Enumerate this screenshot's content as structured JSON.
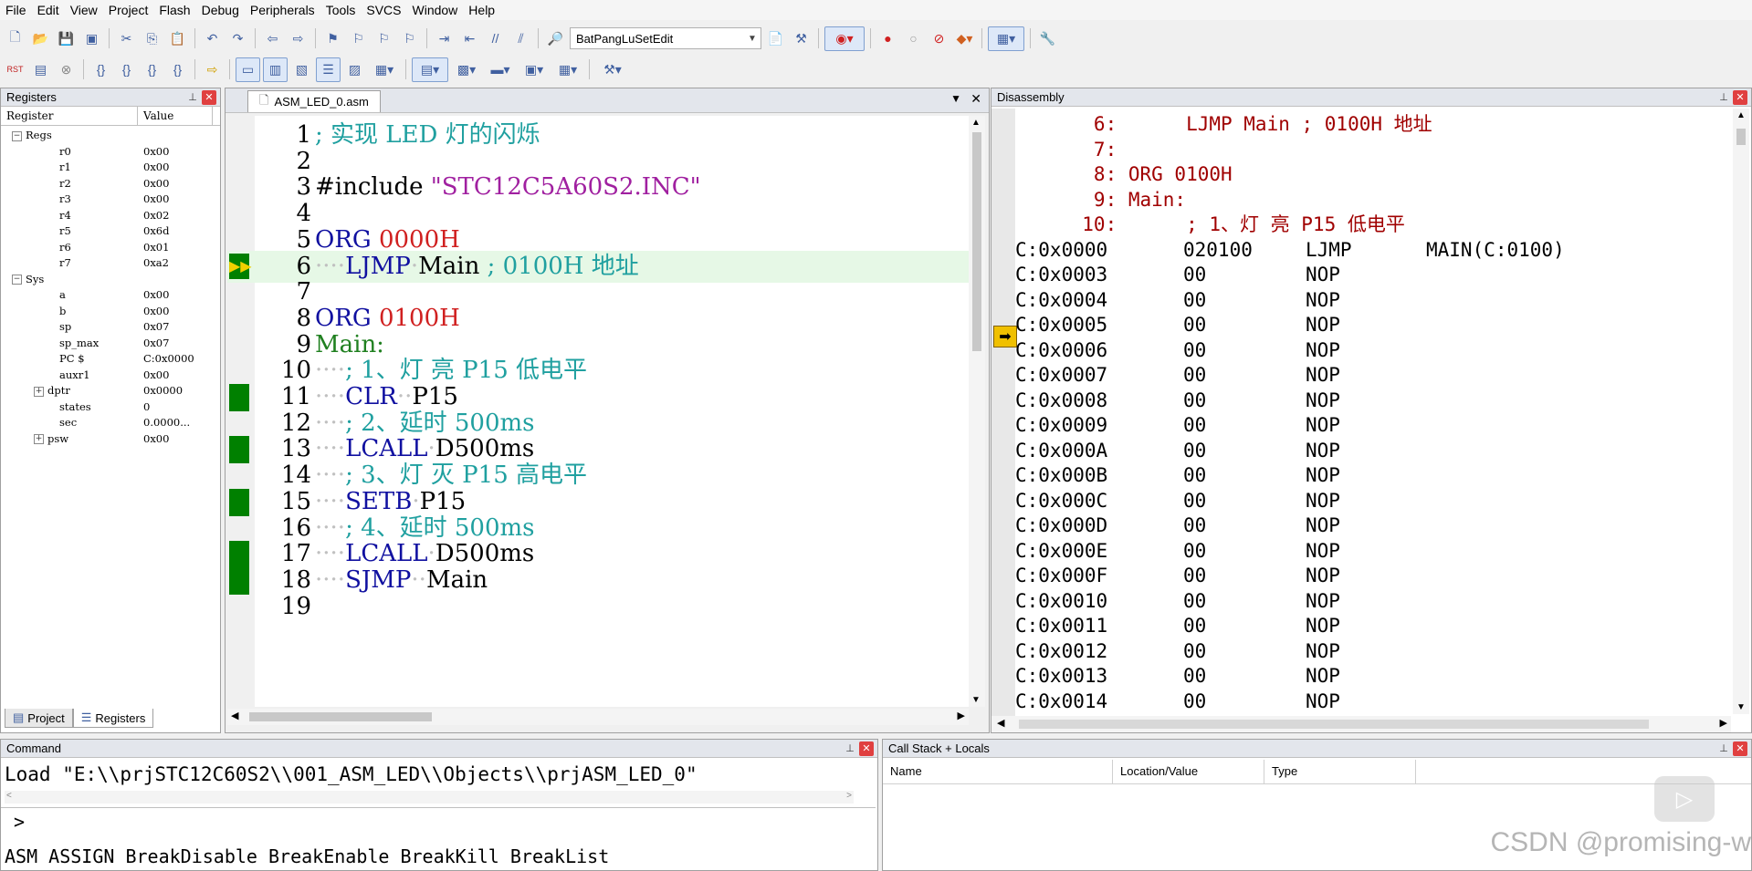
{
  "menubar": [
    "File",
    "Edit",
    "View",
    "Project",
    "Flash",
    "Debug",
    "Peripherals",
    "Tools",
    "SVCS",
    "Window",
    "Help"
  ],
  "toolbar": {
    "target_combo": "BatPangLuSetEdit",
    "rst_label": "RST"
  },
  "registers_panel": {
    "title": "Registers",
    "col_register": "Register",
    "col_value": "Value",
    "groups": [
      {
        "name": "Regs",
        "rows": [
          {
            "name": "r0",
            "value": "0x00"
          },
          {
            "name": "r1",
            "value": "0x00"
          },
          {
            "name": "r2",
            "value": "0x00"
          },
          {
            "name": "r3",
            "value": "0x00"
          },
          {
            "name": "r4",
            "value": "0x02"
          },
          {
            "name": "r5",
            "value": "0x6d"
          },
          {
            "name": "r6",
            "value": "0x01"
          },
          {
            "name": "r7",
            "value": "0xa2"
          }
        ]
      },
      {
        "name": "Sys",
        "rows": [
          {
            "name": "a",
            "value": "0x00"
          },
          {
            "name": "b",
            "value": "0x00"
          },
          {
            "name": "sp",
            "value": "0x07"
          },
          {
            "name": "sp_max",
            "value": "0x07"
          },
          {
            "name": "PC  $",
            "value": "C:0x0000"
          },
          {
            "name": "auxr1",
            "value": "0x00"
          },
          {
            "name": "dptr",
            "value": "0x0000"
          },
          {
            "name": "states",
            "value": "0"
          },
          {
            "name": "sec",
            "value": "0.0000..."
          },
          {
            "name": "psw",
            "value": "0x00"
          }
        ]
      }
    ],
    "tab_project": "Project",
    "tab_registers": "Registers"
  },
  "editor": {
    "tab_label": "ASM_LED_0.asm",
    "lines": [
      {
        "n": "1",
        "text": "; 实现 LED 灯的闪烁"
      },
      {
        "n": "2",
        "text": ""
      },
      {
        "n": "3",
        "text": "#include \"STC12C5A60S2.INC\""
      },
      {
        "n": "4",
        "text": ""
      },
      {
        "n": "5",
        "text": "ORG 0000H"
      },
      {
        "n": "6",
        "text": "    LJMP Main ; 0100H 地址"
      },
      {
        "n": "7",
        "text": ""
      },
      {
        "n": "8",
        "text": "ORG 0100H"
      },
      {
        "n": "9",
        "text": "Main:"
      },
      {
        "n": "10",
        "text": "    ; 1、灯 亮 P15 低电平"
      },
      {
        "n": "11",
        "text": "    CLR  P15"
      },
      {
        "n": "12",
        "text": "    ; 2、延时 500ms"
      },
      {
        "n": "13",
        "text": "    LCALL D500ms"
      },
      {
        "n": "14",
        "text": "    ; 3、灯 灭 P15 高电平"
      },
      {
        "n": "15",
        "text": "    SETB P15"
      },
      {
        "n": "16",
        "text": "    ; 4、延时 500ms"
      },
      {
        "n": "17",
        "text": "    LCALL D500ms"
      },
      {
        "n": "18",
        "text": "    SJMP  Main"
      },
      {
        "n": "19",
        "text": ""
      }
    ]
  },
  "disassembly": {
    "title": "Disassembly",
    "source_lines": [
      "   6:      LJMP Main ; 0100H 地址",
      "   7: ",
      "   8: ORG 0100H",
      "   9: Main:",
      "  10:      ; 1、灯 亮 P15 低电平"
    ],
    "rows": [
      {
        "addr": "C:0x0000",
        "code": "020100",
        "mnem": "LJMP",
        "operand": "MAIN(C:0100)"
      },
      {
        "addr": "C:0x0003",
        "code": "00",
        "mnem": "NOP",
        "operand": ""
      },
      {
        "addr": "C:0x0004",
        "code": "00",
        "mnem": "NOP",
        "operand": ""
      },
      {
        "addr": "C:0x0005",
        "code": "00",
        "mnem": "NOP",
        "operand": ""
      },
      {
        "addr": "C:0x0006",
        "code": "00",
        "mnem": "NOP",
        "operand": ""
      },
      {
        "addr": "C:0x0007",
        "code": "00",
        "mnem": "NOP",
        "operand": ""
      },
      {
        "addr": "C:0x0008",
        "code": "00",
        "mnem": "NOP",
        "operand": ""
      },
      {
        "addr": "C:0x0009",
        "code": "00",
        "mnem": "NOP",
        "operand": ""
      },
      {
        "addr": "C:0x000A",
        "code": "00",
        "mnem": "NOP",
        "operand": ""
      },
      {
        "addr": "C:0x000B",
        "code": "00",
        "mnem": "NOP",
        "operand": ""
      },
      {
        "addr": "C:0x000C",
        "code": "00",
        "mnem": "NOP",
        "operand": ""
      },
      {
        "addr": "C:0x000D",
        "code": "00",
        "mnem": "NOP",
        "operand": ""
      },
      {
        "addr": "C:0x000E",
        "code": "00",
        "mnem": "NOP",
        "operand": ""
      },
      {
        "addr": "C:0x000F",
        "code": "00",
        "mnem": "NOP",
        "operand": ""
      },
      {
        "addr": "C:0x0010",
        "code": "00",
        "mnem": "NOP",
        "operand": ""
      },
      {
        "addr": "C:0x0011",
        "code": "00",
        "mnem": "NOP",
        "operand": ""
      },
      {
        "addr": "C:0x0012",
        "code": "00",
        "mnem": "NOP",
        "operand": ""
      },
      {
        "addr": "C:0x0013",
        "code": "00",
        "mnem": "NOP",
        "operand": ""
      },
      {
        "addr": "C:0x0014",
        "code": "00",
        "mnem": "NOP",
        "operand": ""
      }
    ]
  },
  "command": {
    "title": "Command",
    "output": "Load \"E:\\\\prjSTC12C60S2\\\\001_ASM_LED\\\\Objects\\\\prjASM_LED_0\"",
    "prompt": ">",
    "hint": "ASM ASSIGN BreakDisable BreakEnable BreakKill BreakList"
  },
  "callstack": {
    "title": "Call Stack + Locals",
    "columns": [
      "Name",
      "Location/Value",
      "Type"
    ]
  },
  "watermark": "CSDN @promising-w"
}
